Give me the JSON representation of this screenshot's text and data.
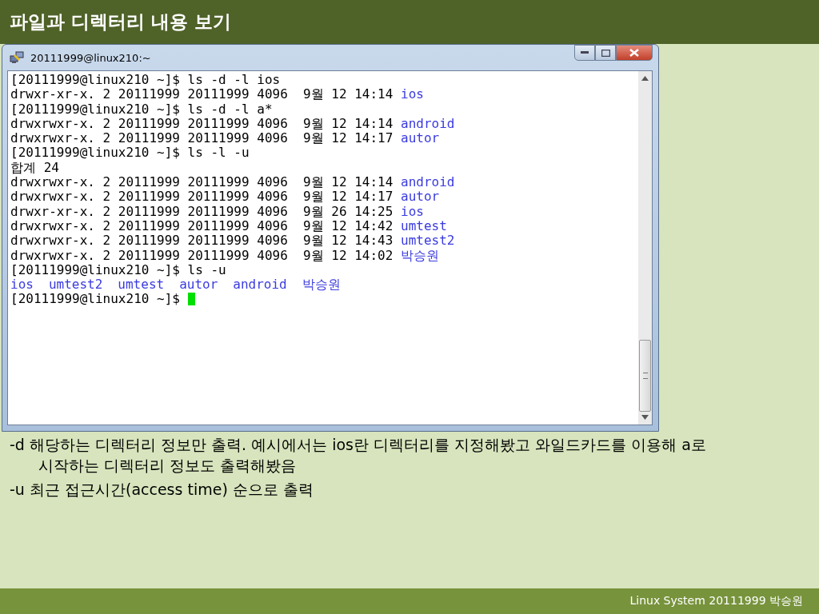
{
  "slide_title": "파일과 디렉터리 내용 보기",
  "terminal": {
    "title": "20111999@linux210:~",
    "lines": [
      {
        "segments": [
          {
            "kind": "plain",
            "text": "[20111999@linux210 ~]$ ls -d -l ios"
          }
        ]
      },
      {
        "segments": [
          {
            "kind": "plain",
            "text": "drwxr-xr-x. 2 20111999 20111999 4096  9월 12 14:14 "
          },
          {
            "kind": "dir",
            "text": "ios"
          }
        ]
      },
      {
        "segments": [
          {
            "kind": "plain",
            "text": "[20111999@linux210 ~]$ ls -d -l a*"
          }
        ]
      },
      {
        "segments": [
          {
            "kind": "plain",
            "text": "drwxrwxr-x. 2 20111999 20111999 4096  9월 12 14:14 "
          },
          {
            "kind": "dir",
            "text": "android"
          }
        ]
      },
      {
        "segments": [
          {
            "kind": "plain",
            "text": "drwxrwxr-x. 2 20111999 20111999 4096  9월 12 14:17 "
          },
          {
            "kind": "dir",
            "text": "autor"
          }
        ]
      },
      {
        "segments": [
          {
            "kind": "plain",
            "text": "[20111999@linux210 ~]$ ls -l -u"
          }
        ]
      },
      {
        "segments": [
          {
            "kind": "plain",
            "text": "합계 24"
          }
        ]
      },
      {
        "segments": [
          {
            "kind": "plain",
            "text": "drwxrwxr-x. 2 20111999 20111999 4096  9월 12 14:14 "
          },
          {
            "kind": "dir",
            "text": "android"
          }
        ]
      },
      {
        "segments": [
          {
            "kind": "plain",
            "text": "drwxrwxr-x. 2 20111999 20111999 4096  9월 12 14:17 "
          },
          {
            "kind": "dir",
            "text": "autor"
          }
        ]
      },
      {
        "segments": [
          {
            "kind": "plain",
            "text": "drwxr-xr-x. 2 20111999 20111999 4096  9월 26 14:25 "
          },
          {
            "kind": "dir",
            "text": "ios"
          }
        ]
      },
      {
        "segments": [
          {
            "kind": "plain",
            "text": "drwxrwxr-x. 2 20111999 20111999 4096  9월 12 14:42 "
          },
          {
            "kind": "dir",
            "text": "umtest"
          }
        ]
      },
      {
        "segments": [
          {
            "kind": "plain",
            "text": "drwxrwxr-x. 2 20111999 20111999 4096  9월 12 14:43 "
          },
          {
            "kind": "dir",
            "text": "umtest2"
          }
        ]
      },
      {
        "segments": [
          {
            "kind": "plain",
            "text": "drwxrwxr-x. 2 20111999 20111999 4096  9월 12 14:02 "
          },
          {
            "kind": "dir",
            "text": "박승원"
          }
        ]
      },
      {
        "segments": [
          {
            "kind": "plain",
            "text": "[20111999@linux210 ~]$ ls -u"
          }
        ]
      },
      {
        "segments": [
          {
            "kind": "dir",
            "text": "ios"
          },
          {
            "kind": "dir",
            "text": "umtest2"
          },
          {
            "kind": "dir",
            "text": "umtest"
          },
          {
            "kind": "dir",
            "text": "autor"
          },
          {
            "kind": "dir",
            "text": "android"
          },
          {
            "kind": "dir",
            "text": "박승원"
          }
        ]
      },
      {
        "segments": [
          {
            "kind": "plain",
            "text": "[20111999@linux210 ~]$ "
          }
        ],
        "cursor": true
      }
    ]
  },
  "notes": [
    "-d 해당하는 디렉터리 정보만 출력. 예시에서는 ios란 디렉터리를 지정해봤고 와일드카드를 이용해 a로 시작하는 디렉터리 정보도 출력해봤음",
    "-u 최근 접근시간(access time) 순으로 출력"
  ],
  "footer": "Linux System 20111999 박승원"
}
